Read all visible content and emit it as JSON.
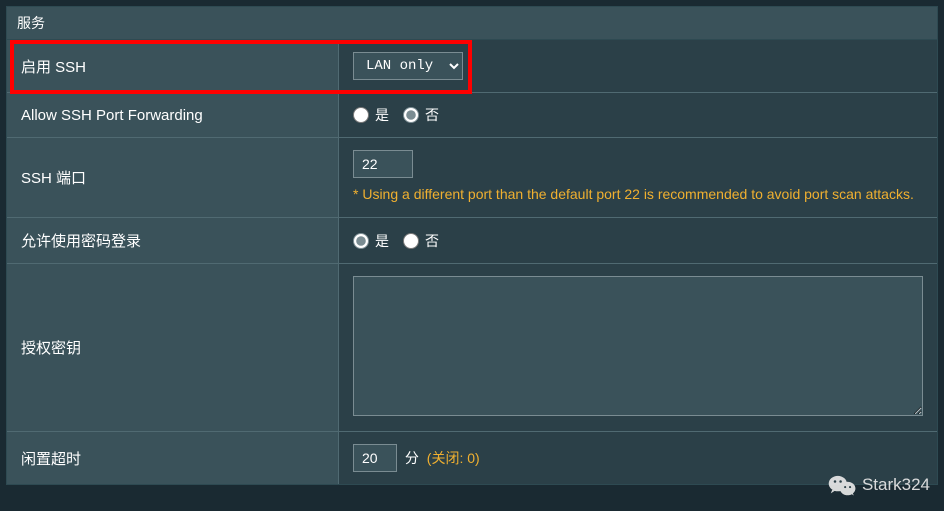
{
  "panel": {
    "title": "服务"
  },
  "rows": {
    "enable_ssh": {
      "label": "启用 SSH",
      "select_value": "LAN only",
      "options": [
        "LAN only"
      ]
    },
    "allow_forward": {
      "label": "Allow SSH Port Forwarding",
      "yes": "是",
      "no": "否"
    },
    "ssh_port": {
      "label": "SSH 端口",
      "value": "22",
      "hint": "* Using a different port than the default port 22 is recommended to avoid port scan attacks."
    },
    "allow_pw": {
      "label": "允许使用密码登录",
      "yes": "是",
      "no": "否"
    },
    "auth_key": {
      "label": "授权密钥",
      "value": ""
    },
    "idle": {
      "label": "闲置超时",
      "value": "20",
      "unit": "分",
      "closed": "(关闭: 0)"
    }
  },
  "watermark": {
    "text": "Stark324"
  }
}
